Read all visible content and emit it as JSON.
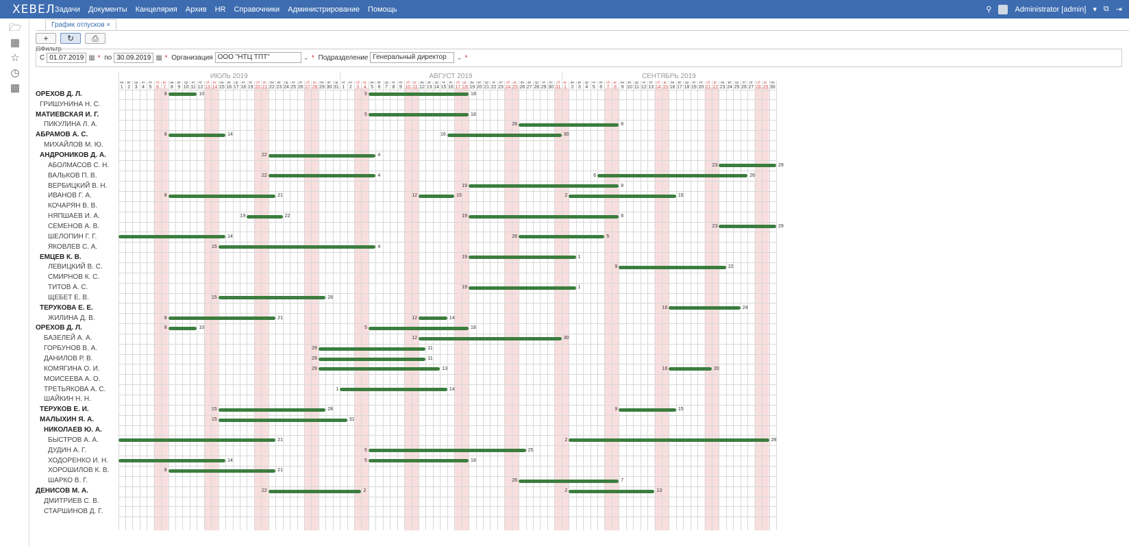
{
  "app": {
    "logo": "ХЕВЕЛ",
    "menu": [
      "Задачи",
      "Документы",
      "Канцелярия",
      "Архив",
      "HR",
      "Справочники",
      "Администрирование",
      "Помощь"
    ],
    "user": "Administrator [admin]"
  },
  "tab": {
    "label": "График отпусков"
  },
  "filter": {
    "legend": "Фильтр",
    "from_label": "С",
    "from_value": "01.07.2019",
    "to_label": "по",
    "to_value": "30.09.2019",
    "org_label": "Организация",
    "org_value": "ООО \"НТЦ ТПТ\"",
    "dept_label": "Подразделение",
    "dept_value": "Генеральный директор"
  },
  "calendar": {
    "months": [
      {
        "name": "ИЮЛЬ 2019",
        "days": 31,
        "first_weekday": 0
      },
      {
        "name": "АВГУСТ 2019",
        "days": 31,
        "first_weekday": 3
      },
      {
        "name": "СЕНТЯБРЬ 2019",
        "days": 30,
        "first_weekday": 6
      }
    ],
    "weekday_names": [
      "пн",
      "вт",
      "ср",
      "чт",
      "пт",
      "сб",
      "вс"
    ],
    "colors": {
      "weekend": "#f9dede",
      "weekend_text": "#d9534f",
      "bar": "#3b7d3e"
    }
  },
  "employees": [
    {
      "name": "ОРЕХОВ Д. Л.",
      "level": 0,
      "bold": true,
      "vacations": [
        {
          "start": 8,
          "end": 11,
          "sl": "8",
          "el": "10"
        },
        {
          "start": 36,
          "end": 49,
          "sl": "5",
          "el": "18"
        }
      ]
    },
    {
      "name": "ГРИШУНИНА Н. С.",
      "level": 1,
      "bold": false,
      "vacations": []
    },
    {
      "name": "МАТИЕВСКАЯ И. Г.",
      "level": 0,
      "bold": true,
      "vacations": [
        {
          "start": 36,
          "end": 49,
          "sl": "5",
          "el": "18"
        }
      ]
    },
    {
      "name": "ПИКУЛИНА Л. А.",
      "level": 2,
      "bold": false,
      "vacations": [
        {
          "start": 57,
          "end": 70,
          "sl": "26",
          "el": "8"
        }
      ]
    },
    {
      "name": "АБРАМОВ А. С.",
      "level": 0,
      "bold": true,
      "vacations": [
        {
          "start": 8,
          "end": 15,
          "sl": "8",
          "el": "14"
        },
        {
          "start": 47,
          "end": 62,
          "sl": "16",
          "el": "30"
        }
      ]
    },
    {
      "name": "МИХАЙЛОВ М. Ю.",
      "level": 2,
      "bold": false,
      "vacations": []
    },
    {
      "name": "АНДРОНИКОВ Д. А.",
      "level": 1,
      "bold": true,
      "vacations": [
        {
          "start": 22,
          "end": 36,
          "sl": "22",
          "el": "4"
        }
      ]
    },
    {
      "name": "АБОЛМАСОВ С. Н.",
      "level": 3,
      "bold": false,
      "vacations": [
        {
          "start": 85,
          "end": 92,
          "sl": "23",
          "el": "29"
        }
      ]
    },
    {
      "name": "ВАЛЬКОВ П. В.",
      "level": 3,
      "bold": false,
      "vacations": [
        {
          "start": 22,
          "end": 36,
          "sl": "22",
          "el": "4"
        },
        {
          "start": 68,
          "end": 88,
          "sl": "6",
          "el": "26"
        }
      ]
    },
    {
      "name": "ВЕРБИЦКИЙ В. Н.",
      "level": 3,
      "bold": false,
      "vacations": [
        {
          "start": 50,
          "end": 70,
          "sl": "19",
          "el": "8"
        }
      ]
    },
    {
      "name": "ИВАНОВ Г. А.",
      "level": 3,
      "bold": false,
      "vacations": [
        {
          "start": 8,
          "end": 22,
          "sl": "8",
          "el": "21"
        },
        {
          "start": 43,
          "end": 47,
          "sl": "12",
          "el": "15"
        },
        {
          "start": 64,
          "end": 78,
          "sl": "2",
          "el": "15"
        }
      ]
    },
    {
      "name": "КОЧАРЯН В. В.",
      "level": 3,
      "bold": false,
      "vacations": []
    },
    {
      "name": "НЯПШАЕВ И. А.",
      "level": 3,
      "bold": false,
      "vacations": [
        {
          "start": 19,
          "end": 23,
          "sl": "19",
          "el": "22"
        },
        {
          "start": 50,
          "end": 70,
          "sl": "19",
          "el": "8"
        }
      ]
    },
    {
      "name": "СЕМЕНОВ А. В.",
      "level": 3,
      "bold": false,
      "vacations": [
        {
          "start": 85,
          "end": 92,
          "sl": "23",
          "el": "29"
        }
      ]
    },
    {
      "name": "ШЕЛОПИН Г. Г.",
      "level": 3,
      "bold": false,
      "vacations": [
        {
          "start": 1,
          "end": 15,
          "sl": "",
          "el": "14"
        },
        {
          "start": 57,
          "end": 68,
          "sl": "26",
          "el": "5"
        }
      ]
    },
    {
      "name": "ЯКОВЛЕВ С. А.",
      "level": 3,
      "bold": false,
      "vacations": [
        {
          "start": 15,
          "end": 36,
          "sl": "15",
          "el": "4"
        }
      ]
    },
    {
      "name": "ЕМЦЕВ К. В.",
      "level": 1,
      "bold": true,
      "vacations": [
        {
          "start": 50,
          "end": 64,
          "sl": "19",
          "el": "1"
        }
      ]
    },
    {
      "name": "ЛЕВИЦКИЙ В. С.",
      "level": 3,
      "bold": false,
      "vacations": [
        {
          "start": 71,
          "end": 85,
          "sl": "9",
          "el": "22"
        }
      ]
    },
    {
      "name": "СМИРНОВ К. С.",
      "level": 3,
      "bold": false,
      "vacations": []
    },
    {
      "name": "ТИТОВ А. С.",
      "level": 3,
      "bold": false,
      "vacations": [
        {
          "start": 50,
          "end": 64,
          "sl": "19",
          "el": "1"
        }
      ]
    },
    {
      "name": "ЩЕБЕТ Е. В.",
      "level": 3,
      "bold": false,
      "vacations": [
        {
          "start": 15,
          "end": 29,
          "sl": "15",
          "el": "28"
        }
      ]
    },
    {
      "name": "ТЕРУКОВА Е. Е.",
      "level": 1,
      "bold": true,
      "vacations": [
        {
          "start": 78,
          "end": 87,
          "sl": "16",
          "el": "24"
        }
      ]
    },
    {
      "name": "ЖИЛИНА Д. В.",
      "level": 3,
      "bold": false,
      "vacations": [
        {
          "start": 8,
          "end": 22,
          "sl": "8",
          "el": "21"
        },
        {
          "start": 43,
          "end": 46,
          "sl": "12",
          "el": "14"
        }
      ]
    },
    {
      "name": "ОРЕХОВ Д. Л.",
      "level": 0,
      "bold": true,
      "vacations": [
        {
          "start": 8,
          "end": 11,
          "sl": "8",
          "el": "10"
        },
        {
          "start": 36,
          "end": 49,
          "sl": "5",
          "el": "18"
        }
      ]
    },
    {
      "name": "БАЗЕЛЕЙ А. А.",
      "level": 2,
      "bold": false,
      "vacations": [
        {
          "start": 43,
          "end": 62,
          "sl": "12",
          "el": "30"
        }
      ]
    },
    {
      "name": "ГОРБУНОВ В. А.",
      "level": 2,
      "bold": false,
      "vacations": [
        {
          "start": 29,
          "end": 43,
          "sl": "29",
          "el": "11"
        }
      ]
    },
    {
      "name": "ДАНИЛОВ Р. В.",
      "level": 2,
      "bold": false,
      "vacations": [
        {
          "start": 29,
          "end": 43,
          "sl": "29",
          "el": "11"
        }
      ]
    },
    {
      "name": "КОМЯГИНА О. И.",
      "level": 2,
      "bold": false,
      "vacations": [
        {
          "start": 29,
          "end": 45,
          "sl": "29",
          "el": "13"
        },
        {
          "start": 78,
          "end": 83,
          "sl": "16",
          "el": "20"
        }
      ]
    },
    {
      "name": "МОИСЕЕВА А. О.",
      "level": 2,
      "bold": false,
      "vacations": []
    },
    {
      "name": "ТРЕТЬЯКОВА А. С.",
      "level": 2,
      "bold": false,
      "vacations": [
        {
          "start": 32,
          "end": 46,
          "sl": "1",
          "el": "14"
        }
      ]
    },
    {
      "name": "ШАЙКИН Н. Н.",
      "level": 2,
      "bold": false,
      "vacations": []
    },
    {
      "name": "ТЕРУКОВ Е. И.",
      "level": 1,
      "bold": true,
      "vacations": [
        {
          "start": 15,
          "end": 29,
          "sl": "15",
          "el": "28"
        },
        {
          "start": 71,
          "end": 78,
          "sl": "9",
          "el": "15"
        }
      ]
    },
    {
      "name": "МАЛЫХИН Я. А.",
      "level": 1,
      "bold": true,
      "vacations": [
        {
          "start": 15,
          "end": 32,
          "sl": "15",
          "el": "31"
        }
      ]
    },
    {
      "name": "НИКОЛАЕВ Ю. А.",
      "level": 2,
      "bold": true,
      "vacations": []
    },
    {
      "name": "БЫСТРОВ А. А.",
      "level": 3,
      "bold": false,
      "vacations": [
        {
          "start": 1,
          "end": 22,
          "sl": "",
          "el": "21"
        },
        {
          "start": 64,
          "end": 91,
          "sl": "2",
          "el": "28"
        }
      ]
    },
    {
      "name": "ДУДИН А. Г.",
      "level": 3,
      "bold": false,
      "vacations": [
        {
          "start": 36,
          "end": 57,
          "sl": "5",
          "el": "25"
        }
      ]
    },
    {
      "name": "ХОДОРЕНКО И. Н.",
      "level": 3,
      "bold": false,
      "vacations": [
        {
          "start": 1,
          "end": 15,
          "sl": "",
          "el": "14"
        },
        {
          "start": 36,
          "end": 49,
          "sl": "5",
          "el": "18"
        }
      ]
    },
    {
      "name": "ХОРОШИЛОВ К. В.",
      "level": 3,
      "bold": false,
      "vacations": [
        {
          "start": 8,
          "end": 22,
          "sl": "8",
          "el": "21"
        }
      ]
    },
    {
      "name": "ШАРКО В. Г.",
      "level": 3,
      "bold": false,
      "vacations": [
        {
          "start": 57,
          "end": 70,
          "sl": "26",
          "el": "7"
        }
      ]
    },
    {
      "name": "ДЕНИСОВ М. А.",
      "level": 0,
      "bold": true,
      "vacations": [
        {
          "start": 22,
          "end": 34,
          "sl": "22",
          "el": "2"
        },
        {
          "start": 64,
          "end": 75,
          "sl": "2",
          "el": "13"
        }
      ]
    },
    {
      "name": "ДМИТРИЕВ С. В.",
      "level": 2,
      "bold": false,
      "vacations": []
    },
    {
      "name": "СТАРШИНОВ Д. Г.",
      "level": 2,
      "bold": false,
      "vacations": []
    }
  ]
}
